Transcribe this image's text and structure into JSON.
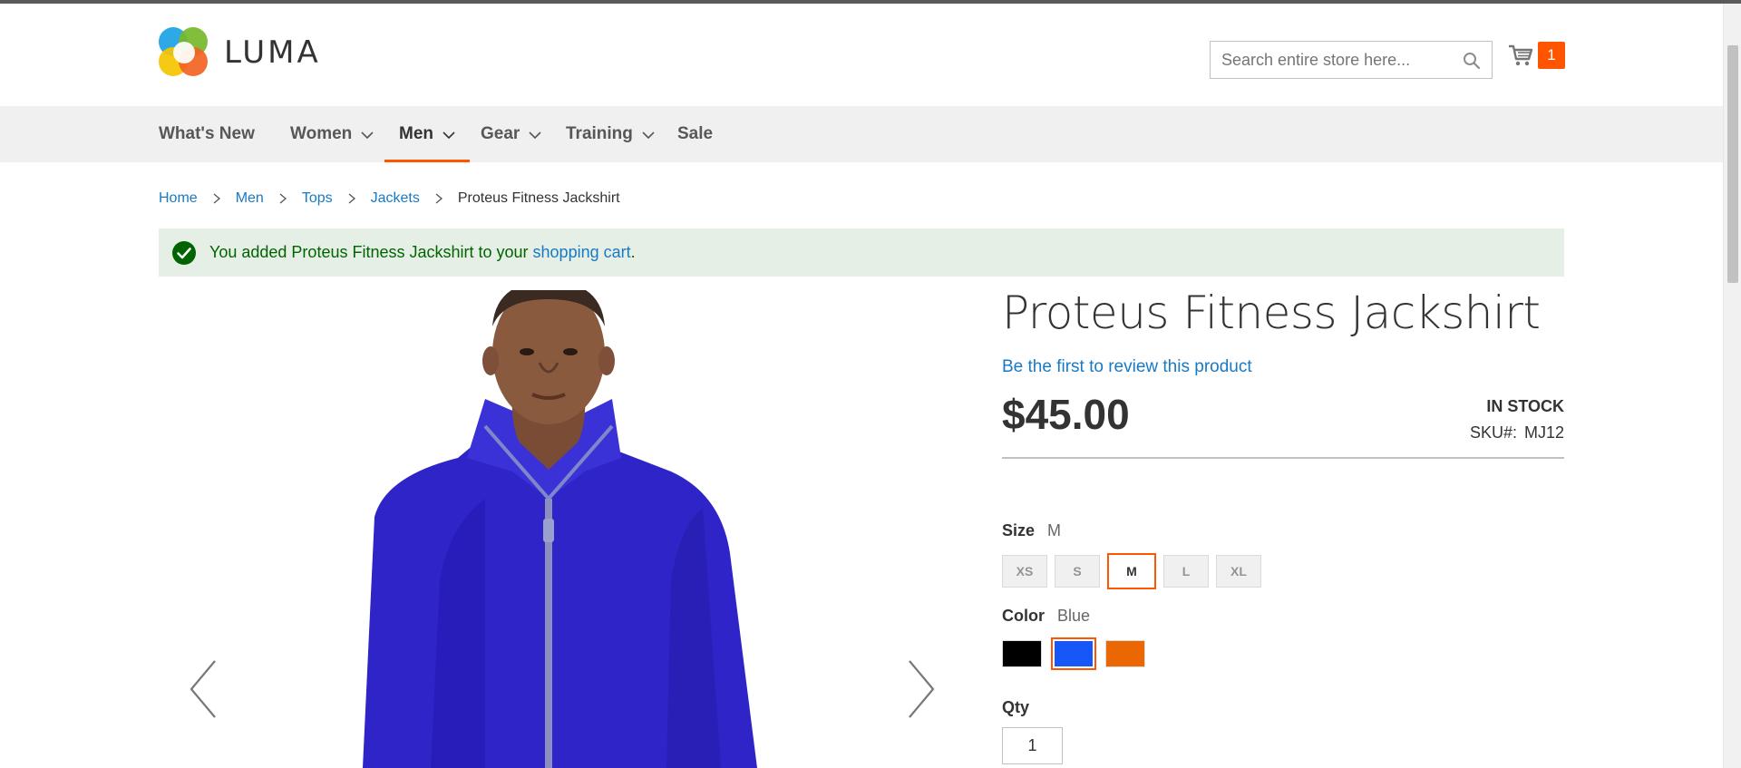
{
  "header": {
    "logo_text": "LUMA",
    "search_placeholder": "Search entire store here...",
    "cart_count": "1"
  },
  "nav": {
    "items": [
      {
        "label": "What's New"
      },
      {
        "label": "Women"
      },
      {
        "label": "Men"
      },
      {
        "label": "Gear"
      },
      {
        "label": "Training"
      },
      {
        "label": "Sale"
      }
    ],
    "active": "Men"
  },
  "breadcrumbs": {
    "items": [
      "Home",
      "Men",
      "Tops",
      "Jackets"
    ],
    "current": "Proteus Fitness Jackshirt"
  },
  "message": {
    "prefix": "You added Proteus Fitness Jackshirt to your ",
    "link": "shopping cart",
    "suffix": "."
  },
  "product": {
    "name": "Proteus Fitness Jackshirt",
    "review_link": "Be the first to review this product",
    "price": "$45.00",
    "stock": "In stock",
    "sku_label": "SKU#:",
    "sku": "MJ12",
    "size_label": "Size",
    "size_selected": "M",
    "sizes": [
      "XS",
      "S",
      "M",
      "L",
      "XL"
    ],
    "color_label": "Color",
    "color_selected": "Blue",
    "colors": [
      {
        "name": "Black",
        "hex": "#000000"
      },
      {
        "name": "Blue",
        "hex": "#1857f7"
      },
      {
        "name": "Orange",
        "hex": "#eb6703"
      }
    ],
    "qty_label": "Qty",
    "qty": "1"
  },
  "colors": {
    "accent": "#ff5501",
    "link": "#1979c3",
    "success_bg": "#e5efe5",
    "success_text": "#006400"
  }
}
